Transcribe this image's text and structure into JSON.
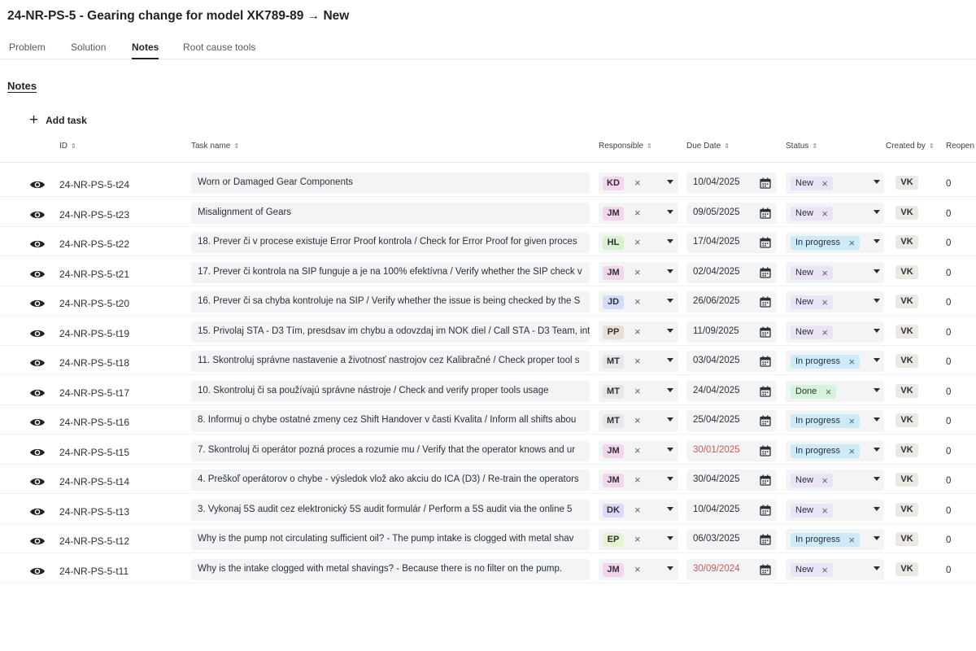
{
  "title": "24-NR-PS-5 - Gearing change for model XK789-89 → New",
  "tabs": [
    {
      "label": "Problem",
      "active": false
    },
    {
      "label": "Solution",
      "active": false
    },
    {
      "label": "Notes",
      "active": true
    },
    {
      "label": "Root cause tools",
      "active": false
    }
  ],
  "section_title": "Notes",
  "add_task_label": "Add task",
  "columns": {
    "id": "ID",
    "task_name": "Task name",
    "responsible": "Responsible",
    "due_date": "Due Date",
    "status": "Status",
    "created_by": "Created by",
    "reopen": "Reopen"
  },
  "colors": {
    "KD": "#f3d5ec",
    "JM": "#f3d5ec",
    "HL": "#d8f2d0",
    "JD": "#d4dcf7",
    "PP": "#e8e0d8",
    "MT": "#e6e7e9",
    "DK": "#dcd9f5",
    "EP": "#e6f5cf",
    "status_new": "#ebe4f6",
    "status_in_progress": "#cdeaf8",
    "status_done": "#d5f3d8",
    "overdue": "#d9534f"
  },
  "tasks": [
    {
      "id": "24-NR-PS-5-t24",
      "name": "Worn or Damaged Gear Components",
      "responsible": "KD",
      "due": "10/04/2025",
      "overdue": false,
      "status": "New",
      "status_key": "status_new",
      "created_by": "VK",
      "reopen": "0"
    },
    {
      "id": "24-NR-PS-5-t23",
      "name": "Misalignment of Gears",
      "responsible": "JM",
      "due": "09/05/2025",
      "overdue": false,
      "status": "New",
      "status_key": "status_new",
      "created_by": "VK",
      "reopen": "0"
    },
    {
      "id": "24-NR-PS-5-t22",
      "name": "18. Prever či v procese existuje Error Proof kontrola / Check for Error Proof for given proces",
      "responsible": "HL",
      "due": "17/04/2025",
      "overdue": false,
      "status": "In progress",
      "status_key": "status_in_progress",
      "created_by": "VK",
      "reopen": "0"
    },
    {
      "id": "24-NR-PS-5-t21",
      "name": "17. Prever či kontrola na SIP funguje a je na 100% efektívna / Verify whether the SIP check v",
      "responsible": "JM",
      "due": "02/04/2025",
      "overdue": false,
      "status": "New",
      "status_key": "status_new",
      "created_by": "VK",
      "reopen": "0"
    },
    {
      "id": "24-NR-PS-5-t20",
      "name": "16. Prever či sa chyba kontroluje na SIP / Verify whether the issue is being checked by the S",
      "responsible": "JD",
      "due": "26/06/2025",
      "overdue": false,
      "status": "New",
      "status_key": "status_new",
      "created_by": "VK",
      "reopen": "0"
    },
    {
      "id": "24-NR-PS-5-t19",
      "name": "15. Privolaj STA - D3 Tím, presdsav im chybu a odovzdaj im NOK diel / Call STA - D3 Team, int",
      "responsible": "PP",
      "due": "11/09/2025",
      "overdue": false,
      "status": "New",
      "status_key": "status_new",
      "created_by": "VK",
      "reopen": "0"
    },
    {
      "id": "24-NR-PS-5-t18",
      "name": "11. Skontroluj správne nastavenie a životnosť nastrojov cez Kalibračné / Check proper tool s",
      "responsible": "MT",
      "due": "03/04/2025",
      "overdue": false,
      "status": "In progress",
      "status_key": "status_in_progress",
      "created_by": "VK",
      "reopen": "0"
    },
    {
      "id": "24-NR-PS-5-t17",
      "name": "10. Skontroluj či sa používajú správne nástroje / Check and verify proper tools usage",
      "responsible": "MT",
      "due": "24/04/2025",
      "overdue": false,
      "status": "Done",
      "status_key": "status_done",
      "created_by": "VK",
      "reopen": "0"
    },
    {
      "id": "24-NR-PS-5-t16",
      "name": "8. Informuj o chybe ostatné zmeny cez Shift Handover v časti Kvalita / Inform all shifts abou",
      "responsible": "MT",
      "due": "25/04/2025",
      "overdue": false,
      "status": "In progress",
      "status_key": "status_in_progress",
      "created_by": "VK",
      "reopen": "0"
    },
    {
      "id": "24-NR-PS-5-t15",
      "name": "7. Skontroluj či operátor pozná proces a rozumie mu / Verify that the operator knows and ur",
      "responsible": "JM",
      "due": "30/01/2025",
      "overdue": true,
      "status": "In progress",
      "status_key": "status_in_progress",
      "created_by": "VK",
      "reopen": "0"
    },
    {
      "id": "24-NR-PS-5-t14",
      "name": "4. Preškoľ operátorov o chybe - výsledok vlož ako akciu do ICA (D3) / Re-train the operators",
      "responsible": "JM",
      "due": "30/04/2025",
      "overdue": false,
      "status": "New",
      "status_key": "status_new",
      "created_by": "VK",
      "reopen": "0"
    },
    {
      "id": "24-NR-PS-5-t13",
      "name": "3. Vykonaj 5S audit cez elektronický 5S audit formulár / Perform a 5S audit via the online 5",
      "responsible": "DK",
      "due": "10/04/2025",
      "overdue": false,
      "status": "New",
      "status_key": "status_new",
      "created_by": "VK",
      "reopen": "0"
    },
    {
      "id": "24-NR-PS-5-t12",
      "name": "Why is the pump not circulating sufficient oil? - The pump intake is clogged with metal shav",
      "responsible": "EP",
      "due": "06/03/2025",
      "overdue": false,
      "status": "In progress",
      "status_key": "status_in_progress",
      "created_by": "VK",
      "reopen": "0"
    },
    {
      "id": "24-NR-PS-5-t11",
      "name": "Why is the intake clogged with metal shavings? - Because there is no filter on the pump.",
      "responsible": "JM",
      "due": "30/09/2024",
      "overdue": true,
      "status": "New",
      "status_key": "status_new",
      "created_by": "VK",
      "reopen": "0"
    }
  ]
}
